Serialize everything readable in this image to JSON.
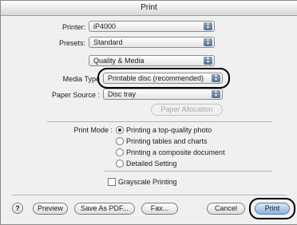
{
  "window": {
    "title": "Print"
  },
  "printer": {
    "label": "Printer:",
    "value": "iP4000"
  },
  "presets": {
    "label": "Presets:",
    "value": "Standard"
  },
  "panel": {
    "value": "Quality & Media"
  },
  "media_type": {
    "label": "Media Type",
    "value": "Printable disc (recommended)"
  },
  "paper_source": {
    "label": "Paper Source :",
    "value": "Disc tray"
  },
  "paper_allocation": {
    "label": "Paper Allocation"
  },
  "print_mode": {
    "label": "Print Mode :",
    "options": [
      "Printing a top-quality photo",
      "Printing tables and charts",
      "Printing a composite document",
      "Detailed Setting"
    ],
    "selected_index": 0
  },
  "grayscale": {
    "label": "Grayscale Printing",
    "checked": false
  },
  "buttons": {
    "help": "?",
    "preview": "Preview",
    "save_pdf": "Save As PDF...",
    "fax": "Fax...",
    "cancel": "Cancel",
    "print": "Print"
  }
}
